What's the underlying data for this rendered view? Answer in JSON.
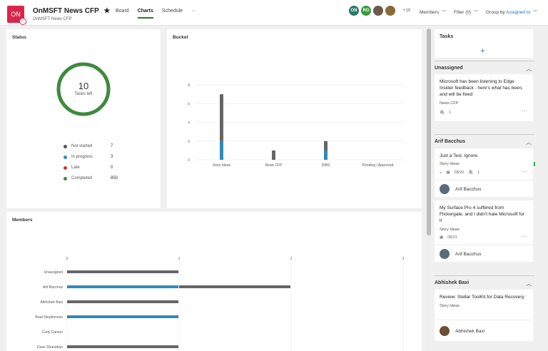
{
  "header": {
    "plan_icon": "ON",
    "plan_title": "OnMSFT News CFP",
    "favorite_icon": "★",
    "plan_subtitle": "OnMSFT News CFP",
    "tabs": [
      {
        "label": "Board"
      },
      {
        "label": "Charts"
      },
      {
        "label": "Schedule"
      }
    ],
    "more_tabs": "···",
    "member_avatars": [
      {
        "initials": "ON",
        "color": "#2a7a6b"
      },
      {
        "initials": "RG",
        "color": "#3c9a3c"
      },
      {
        "initials": "",
        "color": "#6a5a4a"
      },
      {
        "initials": "",
        "color": "#8a6a3a"
      }
    ],
    "member_overflow": "+10",
    "members_label": "Members",
    "filter_label": "Filter (0)",
    "group_by_label": "Group by",
    "group_by_value": "Assigned to"
  },
  "status": {
    "title": "Status",
    "tasks_left_count": "10",
    "tasks_left_label": "Tasks left",
    "ring_color": "#3d8a3d",
    "legend": [
      {
        "label": "Not started",
        "value": "7",
        "color": "#555555"
      },
      {
        "label": "In progress",
        "value": "3",
        "color": "#2f8ab8"
      },
      {
        "label": "Late",
        "value": "0",
        "color": "#d13438"
      },
      {
        "label": "Completed",
        "value": "850",
        "color": "#3d8a3d"
      }
    ]
  },
  "bucket": {
    "title": "Bucket",
    "chart_data": {
      "type": "bar",
      "categories": [
        "Story Ideas",
        "News CFP",
        "DIBS",
        "Pending / Approved"
      ],
      "series": [
        {
          "name": "Not started",
          "values": [
            5,
            1,
            1,
            0
          ],
          "color": "#666666"
        },
        {
          "name": "In progress",
          "values": [
            2,
            0,
            1,
            0
          ],
          "color": "#2f8ab8"
        }
      ],
      "y_ticks": [
        "0",
        "2",
        "4",
        "6",
        "8"
      ],
      "ylim": [
        0,
        8
      ],
      "stacked": true
    }
  },
  "members": {
    "title": "Members",
    "chart_data": {
      "type": "bar",
      "orientation": "horizontal",
      "categories": [
        "Unassigned",
        "Arif Bacchus",
        "Abhishek Baxi",
        "Brad Stephenson",
        "Cody Carson",
        "Dave Shanahan"
      ],
      "series": [
        {
          "name": "In progress",
          "values": [
            0,
            1,
            0,
            1,
            0,
            0
          ],
          "color": "#2f8ab8"
        },
        {
          "name": "Not started",
          "values": [
            1,
            1,
            1,
            0,
            0,
            1
          ],
          "color": "#666666"
        }
      ],
      "x_ticks": [
        "0",
        "1",
        "2",
        "3"
      ],
      "xlim": [
        0,
        3
      ],
      "stacked": true
    }
  },
  "tasks": {
    "title": "Tasks",
    "add_icon": "+",
    "groups": [
      {
        "name": "Unassigned",
        "cards": [
          {
            "title": "Microsoft has been listening to Edge Insider feedback - here's what has been, and will be fixed",
            "label": "News CFP",
            "attachments": "1"
          }
        ]
      },
      {
        "name": "Arif Bacchus",
        "cards": [
          {
            "title": "Just a Test. Ignore.",
            "label": "Story Ideas",
            "due": "08/20",
            "attachments": "1",
            "assignee": "Arif Bacchus"
          },
          {
            "title": "My Surface Pro 4 suffered from Flickergate, and I didn't hate Microsoft for it",
            "label": "Story Ideas",
            "due": "08/21",
            "assignee": "Arif Bacchus"
          }
        ]
      },
      {
        "name": "Abhishek Baxi",
        "cards": [
          {
            "title": "Review: Stellar ToolKit for Data Recovery",
            "label": "Story Ideas",
            "assignee": "Abhishek Baxi"
          }
        ]
      }
    ]
  }
}
